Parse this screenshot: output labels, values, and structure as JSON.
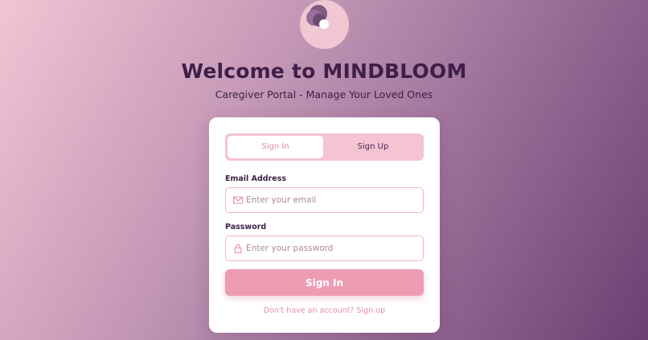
{
  "header": {
    "title": "Welcome to MINDBLOOM",
    "subtitle": "Caregiver Portal - Manage Your Loved Ones"
  },
  "tabs": {
    "sign_in": "Sign In",
    "sign_up": "Sign Up",
    "active": "Sign In"
  },
  "form": {
    "email_label": "Email Address",
    "email_placeholder": "Enter your email",
    "email_value": "",
    "password_label": "Password",
    "password_placeholder": "Enter your password",
    "password_value": "",
    "submit_label": "Sign In",
    "switch_text": "Don't have an account? Sign up"
  },
  "icons": {
    "logo": "flower-logo-icon",
    "email": "mail-icon",
    "password": "lock-icon"
  },
  "colors": {
    "accent": "#ed9cb4",
    "tab_bg": "#f5c4d3",
    "title": "#3f1f4a",
    "link": "#e590ac"
  }
}
